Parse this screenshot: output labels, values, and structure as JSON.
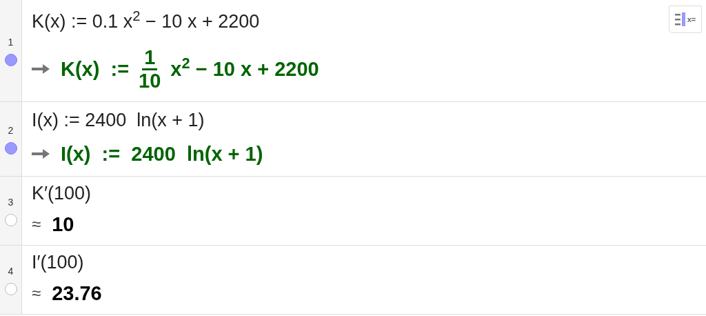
{
  "toggle_button": {
    "label": "x="
  },
  "rows": [
    {
      "number": "1",
      "visible": true,
      "input": "K(x) := 0.1 x$^{2}$ − 10 x + 2200",
      "marker": {
        "kind": "arrow"
      },
      "output": [
        {
          "kind": "text",
          "text": "K(x)  :="
        },
        {
          "kind": "fraction",
          "numerator": "1",
          "denominator": "10"
        },
        {
          "kind": "text",
          "text": "x$^{2}$ − 10 x + 2200"
        }
      ]
    },
    {
      "number": "2",
      "visible": true,
      "input": "I(x) := 2400  ln(x + 1)",
      "marker": {
        "kind": "arrow"
      },
      "output": [
        {
          "kind": "text",
          "text": "I(x)  :=  2400  ln(x + 1)"
        }
      ]
    },
    {
      "number": "3",
      "visible": false,
      "input": "K′(100)",
      "marker": {
        "kind": "approx",
        "symbol": "≈"
      },
      "output": [
        {
          "kind": "text",
          "text": "10"
        }
      ]
    },
    {
      "number": "4",
      "visible": false,
      "input": "I′(100)",
      "marker": {
        "kind": "approx",
        "symbol": "≈"
      },
      "output": [
        {
          "kind": "text",
          "text": "23.76"
        }
      ]
    }
  ]
}
